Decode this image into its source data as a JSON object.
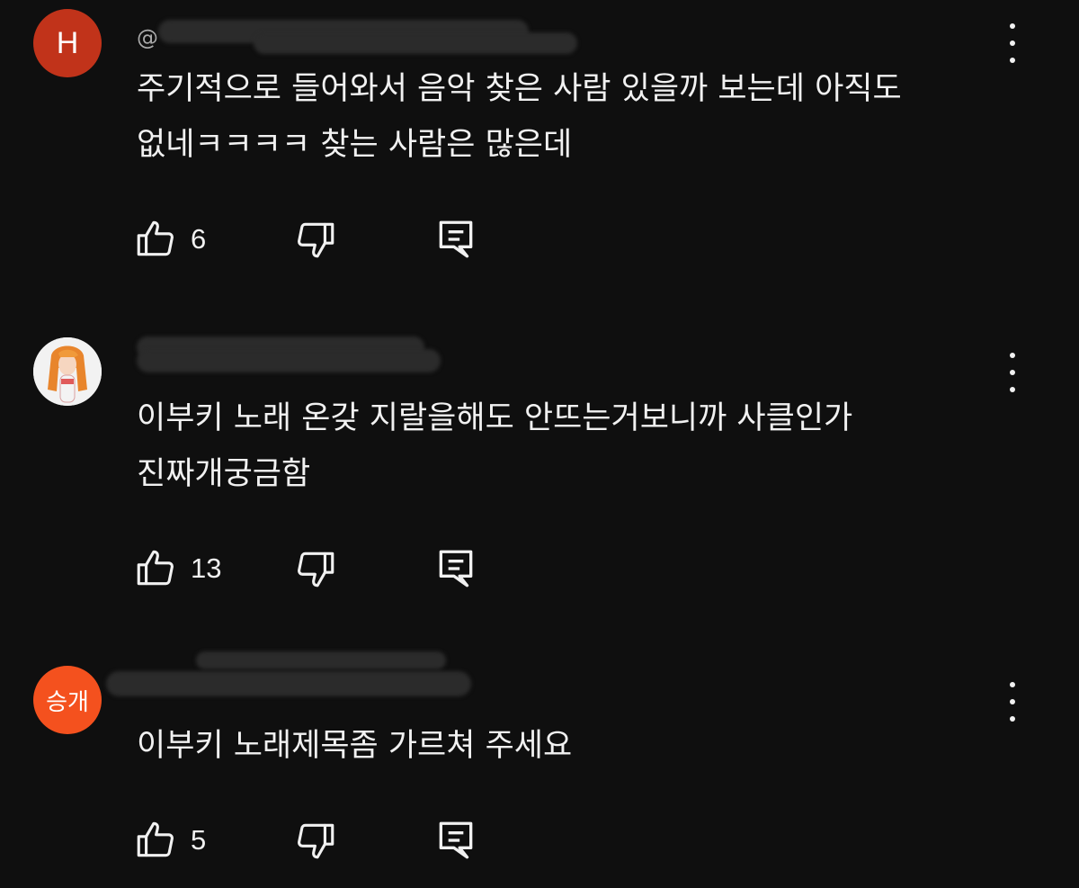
{
  "comments": [
    {
      "avatar_letter": "H",
      "avatar_color": "#c1331a",
      "handle_prefix": "@",
      "text": "주기적으로 들어와서 음악 찾은 사람 있을까 보는데 아직도\n없네ㅋㅋㅋㅋ 찾는 사람은 많은데",
      "likes": "6",
      "like_icon": "thumb-up-icon",
      "dislike_icon": "thumb-down-icon",
      "reply_icon": "reply-icon",
      "more_icon": "more-vert-icon"
    },
    {
      "avatar_letter": "",
      "avatar_color": "#e8e8e8",
      "handle_prefix": "",
      "text": "이부키 노래 온갖 지랄을해도 안뜨는거보니까 사클인가\n진짜개궁금함",
      "likes": "13",
      "like_icon": "thumb-up-icon",
      "dislike_icon": "thumb-down-icon",
      "reply_icon": "reply-icon",
      "more_icon": "more-vert-icon"
    },
    {
      "avatar_letter": "승개",
      "avatar_color": "#f4511e",
      "handle_prefix": "",
      "text": "이부키 노래제목좀 가르쳐 주세요",
      "likes": "5",
      "like_icon": "thumb-up-icon",
      "dislike_icon": "thumb-down-icon",
      "reply_icon": "reply-icon",
      "more_icon": "more-vert-icon"
    }
  ]
}
